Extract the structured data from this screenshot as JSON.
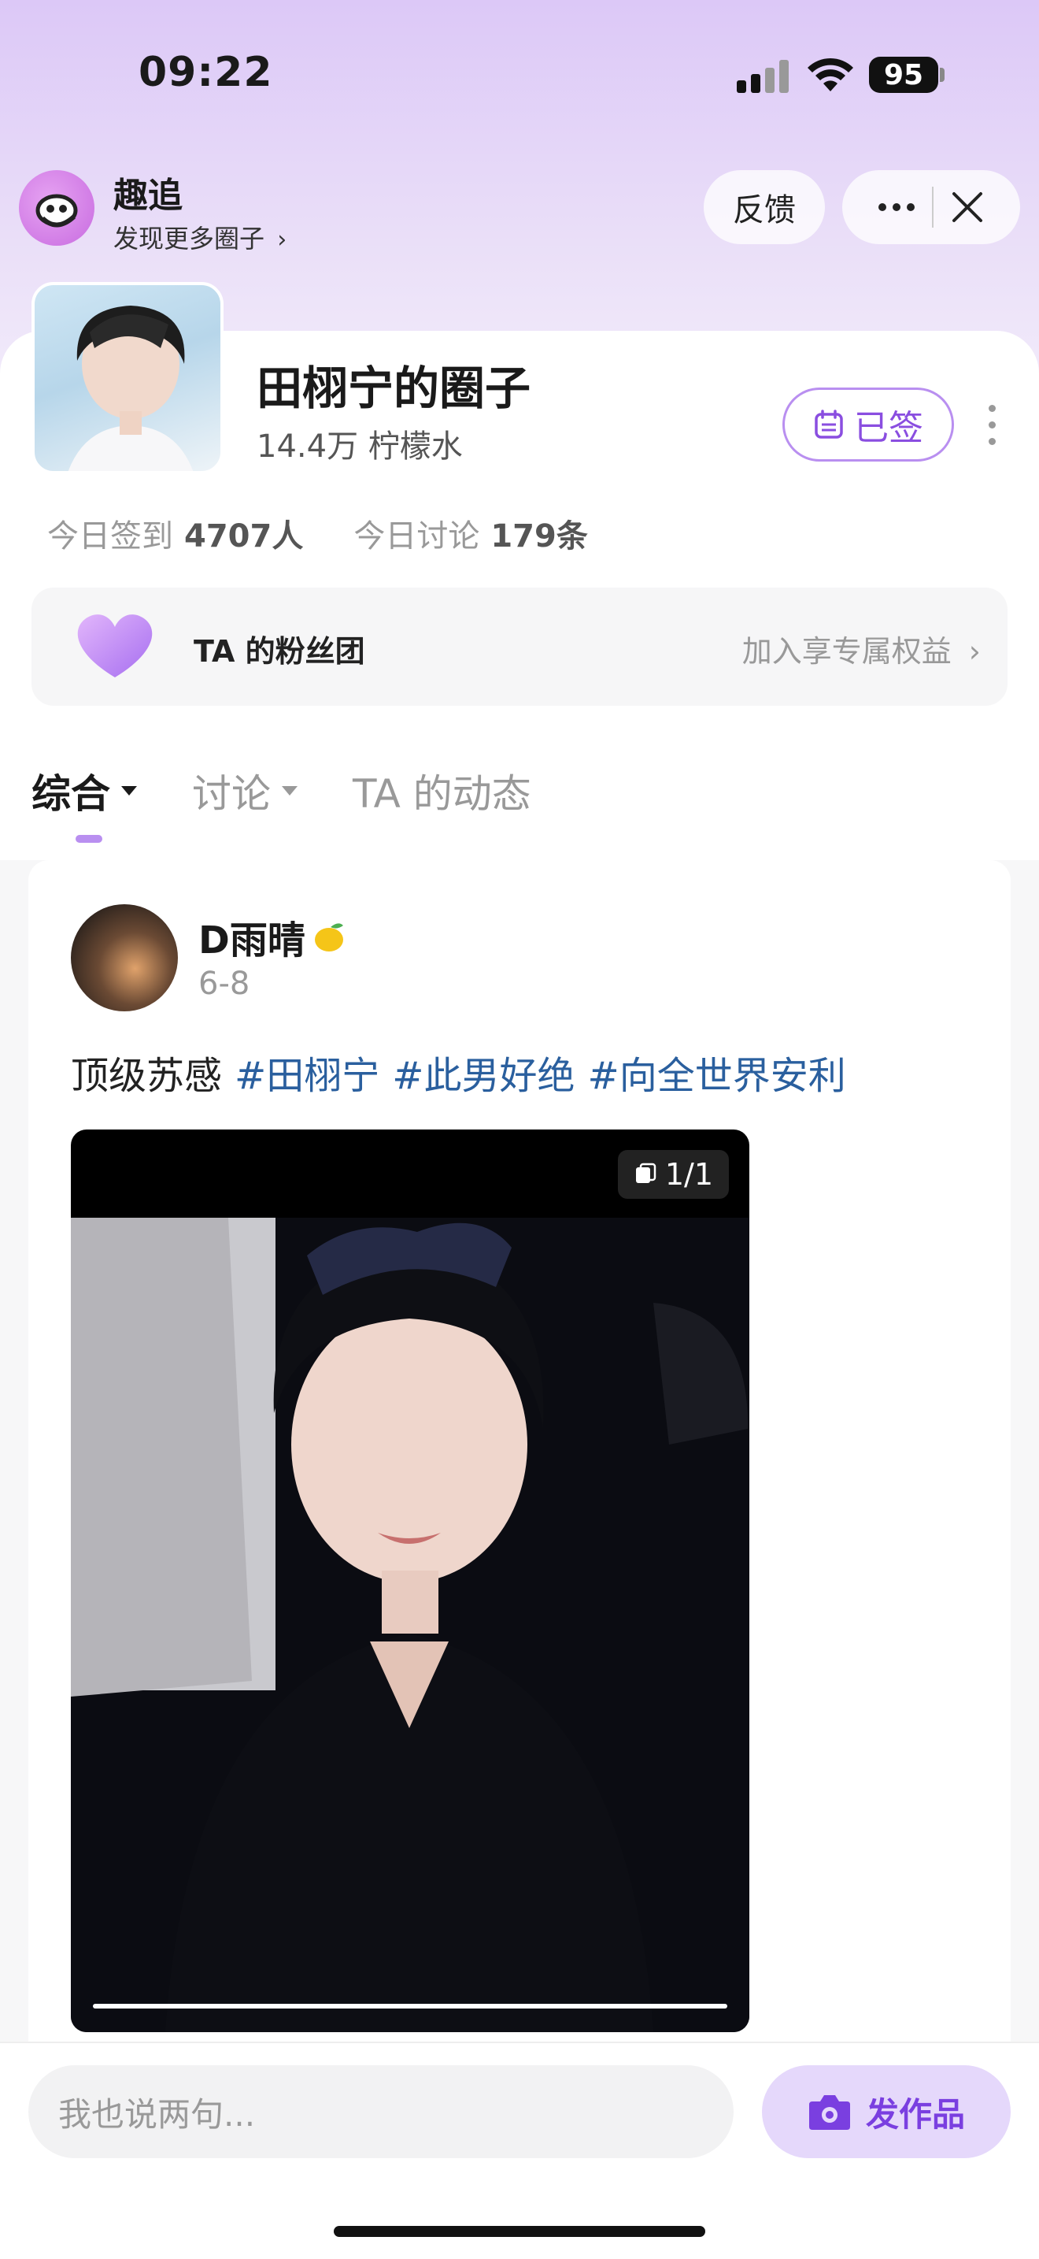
{
  "status_bar": {
    "time": "09:22",
    "battery": "95"
  },
  "mini_app": {
    "name": "趣追",
    "subtitle": "发现更多圈子",
    "feedback_label": "反馈",
    "more_icon": "more-icon",
    "close_icon": "close-icon"
  },
  "circle": {
    "title": "田栩宁的圈子",
    "members": "14.4万 柠檬水",
    "signed_label": "已签",
    "stats": {
      "checkin_label": "今日签到",
      "checkin_value": "4707人",
      "discuss_label": "今日讨论",
      "discuss_value": "179条"
    },
    "fan_group": {
      "label": "TA 的粉丝团",
      "action": "加入享专属权益"
    }
  },
  "tabs": [
    {
      "label": "综合",
      "active": true
    },
    {
      "label": "讨论",
      "active": false
    },
    {
      "label": "TA 的动态",
      "active": false
    }
  ],
  "post": {
    "author": "D雨晴",
    "date": "6-8",
    "text": "顶级苏感",
    "tags": [
      "#田栩宁",
      "#此男好绝",
      "#向全世界安利"
    ],
    "photo_counter": "1/1"
  },
  "bottom": {
    "comment_placeholder": "我也说两句...",
    "publish_label": "发作品"
  },
  "colors": {
    "accent": "#8a4ee0",
    "tag": "#2a5f9e",
    "header_bg": "#dcc8f7"
  }
}
